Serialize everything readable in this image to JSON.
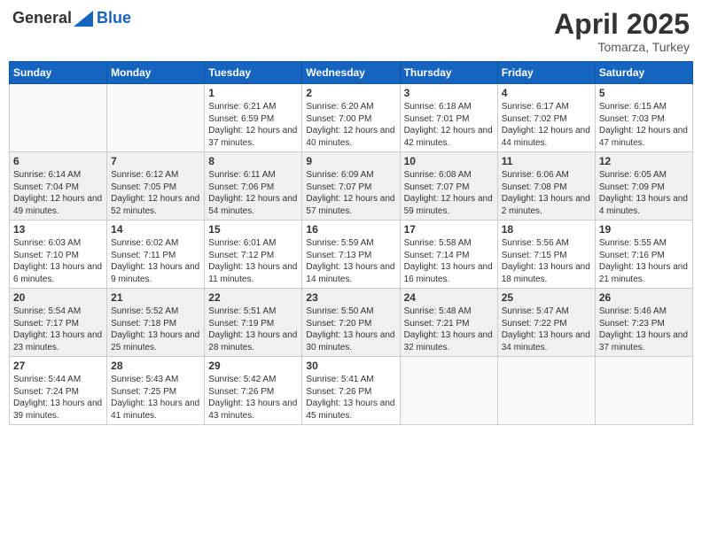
{
  "header": {
    "logo_general": "General",
    "logo_blue": "Blue",
    "month": "April 2025",
    "location": "Tomarza, Turkey"
  },
  "weekdays": [
    "Sunday",
    "Monday",
    "Tuesday",
    "Wednesday",
    "Thursday",
    "Friday",
    "Saturday"
  ],
  "weeks": [
    [
      {
        "day": "",
        "info": ""
      },
      {
        "day": "",
        "info": ""
      },
      {
        "day": "1",
        "info": "Sunrise: 6:21 AM\nSunset: 6:59 PM\nDaylight: 12 hours and 37 minutes."
      },
      {
        "day": "2",
        "info": "Sunrise: 6:20 AM\nSunset: 7:00 PM\nDaylight: 12 hours and 40 minutes."
      },
      {
        "day": "3",
        "info": "Sunrise: 6:18 AM\nSunset: 7:01 PM\nDaylight: 12 hours and 42 minutes."
      },
      {
        "day": "4",
        "info": "Sunrise: 6:17 AM\nSunset: 7:02 PM\nDaylight: 12 hours and 44 minutes."
      },
      {
        "day": "5",
        "info": "Sunrise: 6:15 AM\nSunset: 7:03 PM\nDaylight: 12 hours and 47 minutes."
      }
    ],
    [
      {
        "day": "6",
        "info": "Sunrise: 6:14 AM\nSunset: 7:04 PM\nDaylight: 12 hours and 49 minutes."
      },
      {
        "day": "7",
        "info": "Sunrise: 6:12 AM\nSunset: 7:05 PM\nDaylight: 12 hours and 52 minutes."
      },
      {
        "day": "8",
        "info": "Sunrise: 6:11 AM\nSunset: 7:06 PM\nDaylight: 12 hours and 54 minutes."
      },
      {
        "day": "9",
        "info": "Sunrise: 6:09 AM\nSunset: 7:07 PM\nDaylight: 12 hours and 57 minutes."
      },
      {
        "day": "10",
        "info": "Sunrise: 6:08 AM\nSunset: 7:07 PM\nDaylight: 12 hours and 59 minutes."
      },
      {
        "day": "11",
        "info": "Sunrise: 6:06 AM\nSunset: 7:08 PM\nDaylight: 13 hours and 2 minutes."
      },
      {
        "day": "12",
        "info": "Sunrise: 6:05 AM\nSunset: 7:09 PM\nDaylight: 13 hours and 4 minutes."
      }
    ],
    [
      {
        "day": "13",
        "info": "Sunrise: 6:03 AM\nSunset: 7:10 PM\nDaylight: 13 hours and 6 minutes."
      },
      {
        "day": "14",
        "info": "Sunrise: 6:02 AM\nSunset: 7:11 PM\nDaylight: 13 hours and 9 minutes."
      },
      {
        "day": "15",
        "info": "Sunrise: 6:01 AM\nSunset: 7:12 PM\nDaylight: 13 hours and 11 minutes."
      },
      {
        "day": "16",
        "info": "Sunrise: 5:59 AM\nSunset: 7:13 PM\nDaylight: 13 hours and 14 minutes."
      },
      {
        "day": "17",
        "info": "Sunrise: 5:58 AM\nSunset: 7:14 PM\nDaylight: 13 hours and 16 minutes."
      },
      {
        "day": "18",
        "info": "Sunrise: 5:56 AM\nSunset: 7:15 PM\nDaylight: 13 hours and 18 minutes."
      },
      {
        "day": "19",
        "info": "Sunrise: 5:55 AM\nSunset: 7:16 PM\nDaylight: 13 hours and 21 minutes."
      }
    ],
    [
      {
        "day": "20",
        "info": "Sunrise: 5:54 AM\nSunset: 7:17 PM\nDaylight: 13 hours and 23 minutes."
      },
      {
        "day": "21",
        "info": "Sunrise: 5:52 AM\nSunset: 7:18 PM\nDaylight: 13 hours and 25 minutes."
      },
      {
        "day": "22",
        "info": "Sunrise: 5:51 AM\nSunset: 7:19 PM\nDaylight: 13 hours and 28 minutes."
      },
      {
        "day": "23",
        "info": "Sunrise: 5:50 AM\nSunset: 7:20 PM\nDaylight: 13 hours and 30 minutes."
      },
      {
        "day": "24",
        "info": "Sunrise: 5:48 AM\nSunset: 7:21 PM\nDaylight: 13 hours and 32 minutes."
      },
      {
        "day": "25",
        "info": "Sunrise: 5:47 AM\nSunset: 7:22 PM\nDaylight: 13 hours and 34 minutes."
      },
      {
        "day": "26",
        "info": "Sunrise: 5:46 AM\nSunset: 7:23 PM\nDaylight: 13 hours and 37 minutes."
      }
    ],
    [
      {
        "day": "27",
        "info": "Sunrise: 5:44 AM\nSunset: 7:24 PM\nDaylight: 13 hours and 39 minutes."
      },
      {
        "day": "28",
        "info": "Sunrise: 5:43 AM\nSunset: 7:25 PM\nDaylight: 13 hours and 41 minutes."
      },
      {
        "day": "29",
        "info": "Sunrise: 5:42 AM\nSunset: 7:26 PM\nDaylight: 13 hours and 43 minutes."
      },
      {
        "day": "30",
        "info": "Sunrise: 5:41 AM\nSunset: 7:26 PM\nDaylight: 13 hours and 45 minutes."
      },
      {
        "day": "",
        "info": ""
      },
      {
        "day": "",
        "info": ""
      },
      {
        "day": "",
        "info": ""
      }
    ]
  ]
}
